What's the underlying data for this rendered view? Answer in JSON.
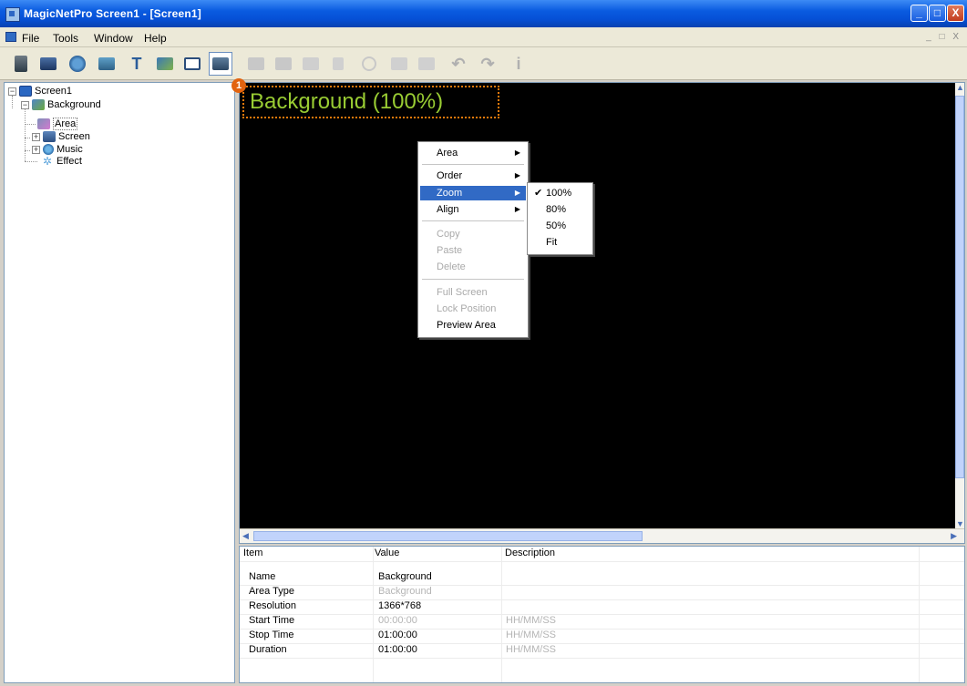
{
  "window": {
    "title": "MagicNetPro Screen1 - [Screen1]",
    "min": "_",
    "max": "□",
    "close": "X"
  },
  "menu": {
    "items": [
      "File",
      "Tools",
      "Window",
      "Help"
    ],
    "mdi_buttons": "_ □ X"
  },
  "toolbar": {
    "text_tool_glyph": "T",
    "undo_glyph": "↶",
    "redo_glyph": "↷",
    "info_glyph": "i"
  },
  "tree": {
    "root": "Screen1",
    "background": "Background",
    "area": "Area",
    "screen": "Screen",
    "music": "Music",
    "effect": "Effect"
  },
  "canvas": {
    "label": "Background (100%)",
    "callout_number": "1"
  },
  "context_menu": {
    "area": "Area",
    "order": "Order",
    "zoom": "Zoom",
    "align": "Align",
    "copy": "Copy",
    "paste": "Paste",
    "delete": "Delete",
    "full_screen": "Full Screen",
    "lock_position": "Lock Position",
    "preview_area": "Preview Area"
  },
  "zoom_submenu": {
    "options": [
      "100%",
      "80%",
      "50%",
      "Fit"
    ],
    "selected": "100%"
  },
  "properties": {
    "headers": {
      "item": "Item",
      "value": "Value",
      "description": "Description"
    },
    "rows": [
      {
        "item": "Name",
        "value": "Background",
        "desc": ""
      },
      {
        "item": "Area Type",
        "value": "Background",
        "desc": ""
      },
      {
        "item": "Resolution",
        "value": "1366*768",
        "desc": ""
      },
      {
        "item": "Start Time",
        "value": "00:00:00",
        "desc": "HH/MM/SS"
      },
      {
        "item": "Stop Time",
        "value": "01:00:00",
        "desc": "HH/MM/SS"
      },
      {
        "item": "Duration",
        "value": "01:00:00",
        "desc": "HH/MM/SS"
      }
    ]
  }
}
